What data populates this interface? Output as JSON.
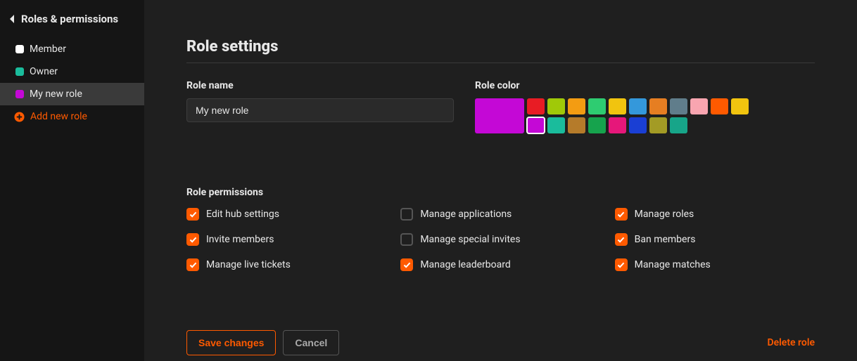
{
  "sidebar": {
    "title": "Roles & permissions",
    "roles": [
      {
        "label": "Member",
        "color": "#ffffff",
        "active": false
      },
      {
        "label": "Owner",
        "color": "#1abc9c",
        "active": false
      },
      {
        "label": "My new role",
        "color": "#c408d6",
        "active": true
      }
    ],
    "add_label": "Add new role"
  },
  "settings": {
    "title": "Role settings",
    "name_label": "Role name",
    "name_value": "My new role",
    "color_label": "Role color",
    "selected_color": "#c408d6",
    "palette": [
      "#e81c24",
      "#a0c908",
      "#f39c12",
      "#2ecc71",
      "#f1c40f",
      "#3498db",
      "#e67e22",
      "#607d8b",
      "#f8a5b0",
      "#ff5a00",
      "#f1c40f",
      "#c408d6",
      "#1abc9c",
      "#b57b2a",
      "#16a34d",
      "#e6177a",
      "#1a3fd4",
      "#a39b25",
      "#17a589"
    ],
    "selected_index": 11
  },
  "permissions": {
    "title": "Role permissions",
    "items": [
      {
        "label": "Edit hub settings",
        "checked": true
      },
      {
        "label": "Manage applications",
        "checked": false
      },
      {
        "label": "Manage roles",
        "checked": true
      },
      {
        "label": "Invite members",
        "checked": true
      },
      {
        "label": "Manage special invites",
        "checked": false
      },
      {
        "label": "Ban members",
        "checked": true
      },
      {
        "label": "Manage live tickets",
        "checked": true
      },
      {
        "label": "Manage leaderboard",
        "checked": true
      },
      {
        "label": "Manage matches",
        "checked": true
      }
    ]
  },
  "footer": {
    "save": "Save changes",
    "cancel": "Cancel",
    "delete": "Delete role"
  }
}
